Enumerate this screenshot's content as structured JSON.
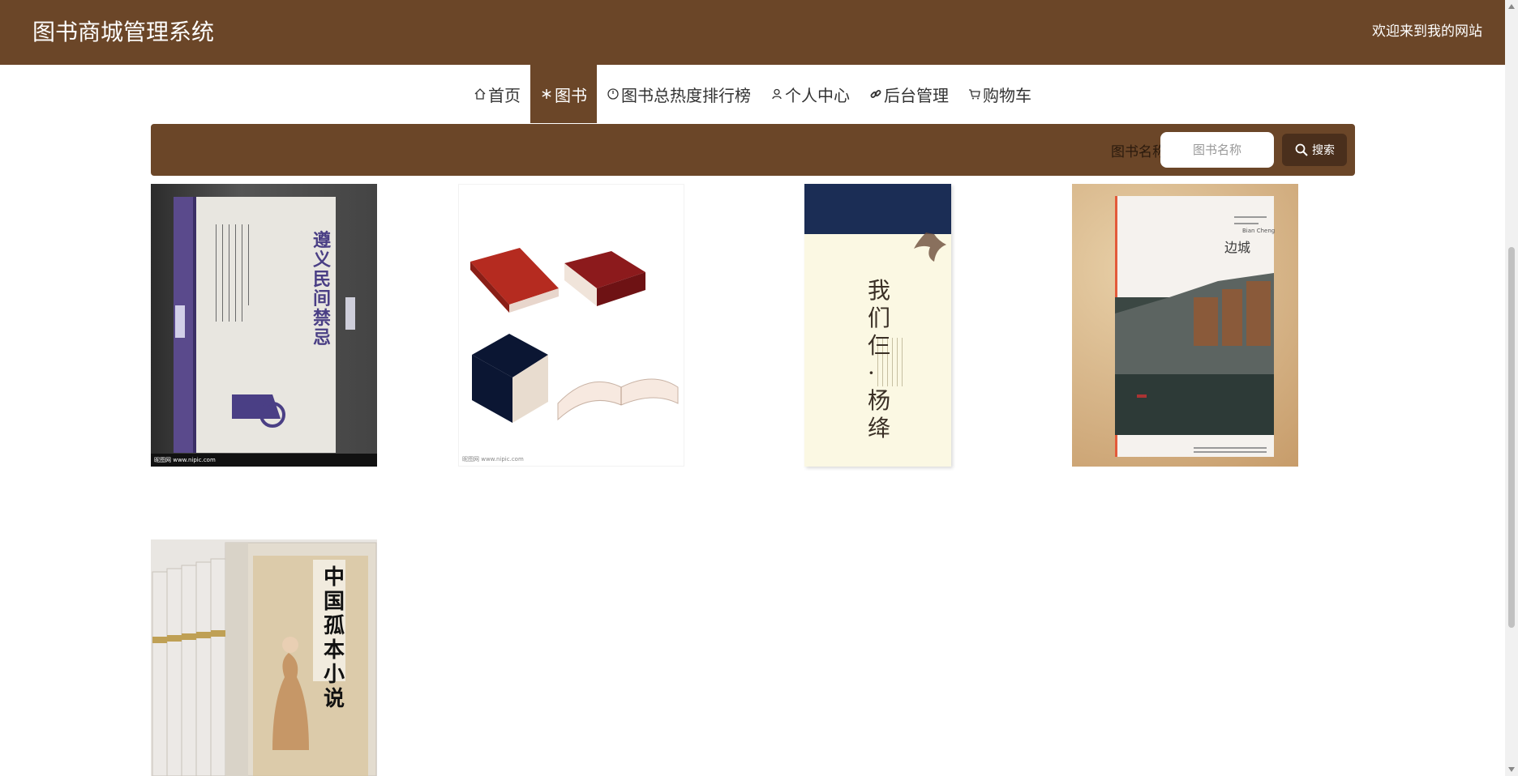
{
  "header": {
    "title": "图书商城管理系统",
    "welcome": "欢迎来到我的网站"
  },
  "nav": {
    "items": [
      {
        "label": "首页",
        "icon": "home-icon"
      },
      {
        "label": "图书",
        "icon": "snowflake-icon"
      },
      {
        "label": "图书总热度排行榜",
        "icon": "clock-icon"
      },
      {
        "label": "个人中心",
        "icon": "user-icon"
      },
      {
        "label": "后台管理",
        "icon": "link-icon"
      },
      {
        "label": "购物车",
        "icon": "cart-icon"
      }
    ],
    "active": "图书"
  },
  "search": {
    "label": "图书名称",
    "placeholder": "图书名称",
    "button": "搜索"
  },
  "books": [
    {
      "cover_text": "遵义民间禁忌",
      "caption": "昵图网 www.nipic.com"
    },
    {
      "cover_text": "",
      "caption": "昵图网 www.nipic.com"
    },
    {
      "cover_text": "我们仨 · 杨绛",
      "caption": ""
    },
    {
      "cover_text": "边城",
      "caption": "Bian Cheng"
    },
    {
      "cover_text": "中国孤本小说",
      "caption": ""
    }
  ],
  "colors": {
    "brand": "#6b4628",
    "button": "#4a2f1c"
  }
}
